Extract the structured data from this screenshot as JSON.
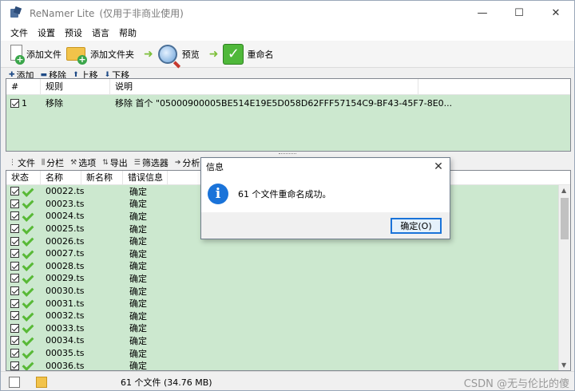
{
  "window": {
    "title": "ReNamer Lite",
    "subtitle": "(仅用于非商业使用)",
    "minimize": "—",
    "maximize": "☐",
    "close": "✕"
  },
  "menu": [
    "文件",
    "设置",
    "预设",
    "语言",
    "帮助"
  ],
  "toolbar": {
    "add_files": "添加文件",
    "add_folder": "添加文件夹",
    "preview": "预览",
    "rename": "重命名"
  },
  "rules_toolbar": {
    "add": "添加",
    "remove": "移除",
    "up": "上移",
    "down": "下移"
  },
  "rules_table": {
    "headers": [
      "#",
      "规则",
      "说明"
    ],
    "rows": [
      {
        "num": "1",
        "rule": "移除",
        "desc": "移除 首个 \"05000900005BE514E19E5D058D62FFF57154C9-BF43-45F7-8E0..."
      }
    ]
  },
  "files_toolbar": [
    "文件",
    "分栏",
    "选项",
    "导出",
    "筛选器",
    "分析"
  ],
  "files_table": {
    "headers": [
      "状态",
      "名称",
      "新名称",
      "错误信息"
    ],
    "rows": [
      {
        "name": "00022.ts",
        "new": "",
        "err": "确定"
      },
      {
        "name": "00023.ts",
        "new": "",
        "err": "确定"
      },
      {
        "name": "00024.ts",
        "new": "",
        "err": "确定"
      },
      {
        "name": "00025.ts",
        "new": "",
        "err": "确定"
      },
      {
        "name": "00026.ts",
        "new": "",
        "err": "确定"
      },
      {
        "name": "00027.ts",
        "new": "",
        "err": "确定"
      },
      {
        "name": "00028.ts",
        "new": "",
        "err": "确定"
      },
      {
        "name": "00029.ts",
        "new": "",
        "err": "确定"
      },
      {
        "name": "00030.ts",
        "new": "",
        "err": "确定"
      },
      {
        "name": "00031.ts",
        "new": "",
        "err": "确定"
      },
      {
        "name": "00032.ts",
        "new": "",
        "err": "确定"
      },
      {
        "name": "00033.ts",
        "new": "",
        "err": "确定"
      },
      {
        "name": "00034.ts",
        "new": "",
        "err": "确定"
      },
      {
        "name": "00035.ts",
        "new": "",
        "err": "确定"
      },
      {
        "name": "00036.ts",
        "new": "",
        "err": "确定"
      }
    ]
  },
  "status": {
    "summary": "61 个文件 (34.76 MB)",
    "watermark": "CSDN @无与伦比的傻"
  },
  "dialog": {
    "title": "信息",
    "message": "61 个文件重命名成功。",
    "ok": "确定(O)",
    "close": "✕"
  },
  "colors": {
    "row_green": "#cce8cf",
    "check_green": "#58b936",
    "info_blue": "#1a73d9"
  }
}
